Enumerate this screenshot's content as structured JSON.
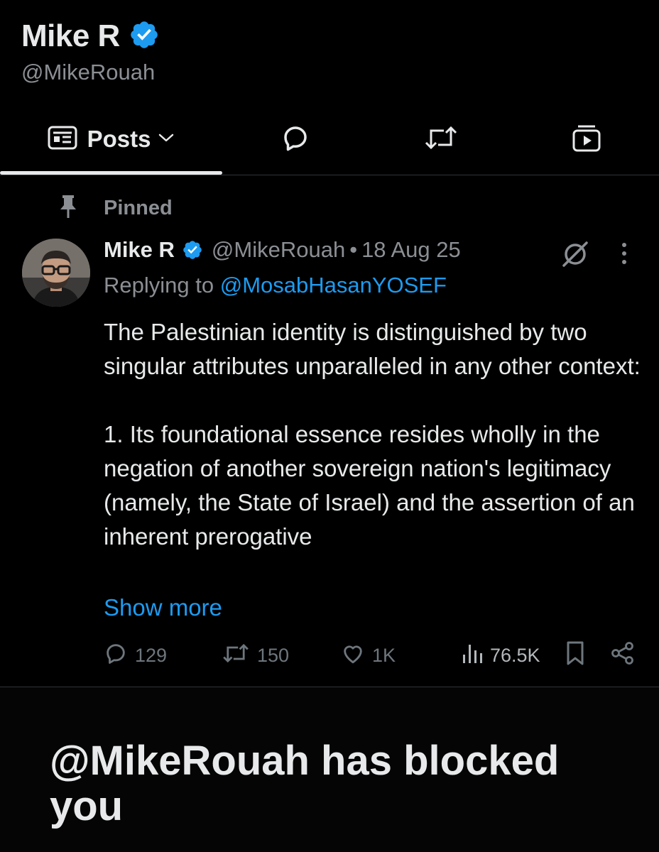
{
  "profile": {
    "name": "Mike R",
    "handle": "@MikeRouah"
  },
  "tabs": {
    "posts_label": "Posts"
  },
  "colors": {
    "background": "#000000",
    "text": "#e7e9ea",
    "muted": "#8b8f94",
    "accent": "#1d9bf0",
    "verified": "#1d9bf0"
  },
  "pinned": {
    "label": "Pinned"
  },
  "tweet": {
    "name": "Mike R",
    "handle": "@MikeRouah",
    "separator": "•",
    "date": "18 Aug 25",
    "replying_prefix": "Replying to ",
    "replying_to": "@MosabHasanYOSEF",
    "text": "The Palestinian identity is distinguished by two singular attributes unparalleled in any other context:\n\n1. Its foundational essence resides wholly in the negation of another sovereign nation's legitimacy (namely, the State of Israel) and the assertion of an inherent prerogative",
    "show_more": "Show more",
    "replies": "129",
    "reposts": "150",
    "likes": "1K",
    "views": "76.5K"
  },
  "blocked": {
    "message": "@MikeRouah has blocked you"
  },
  "icons": [
    "verified-badge-icon",
    "timeline-icon",
    "chevron-down-icon",
    "reply-bubble-icon",
    "repost-icon",
    "media-icon",
    "pin-icon",
    "grok-icon",
    "more-vertical-icon",
    "heart-icon",
    "views-icon",
    "bookmark-icon",
    "share-icon"
  ]
}
